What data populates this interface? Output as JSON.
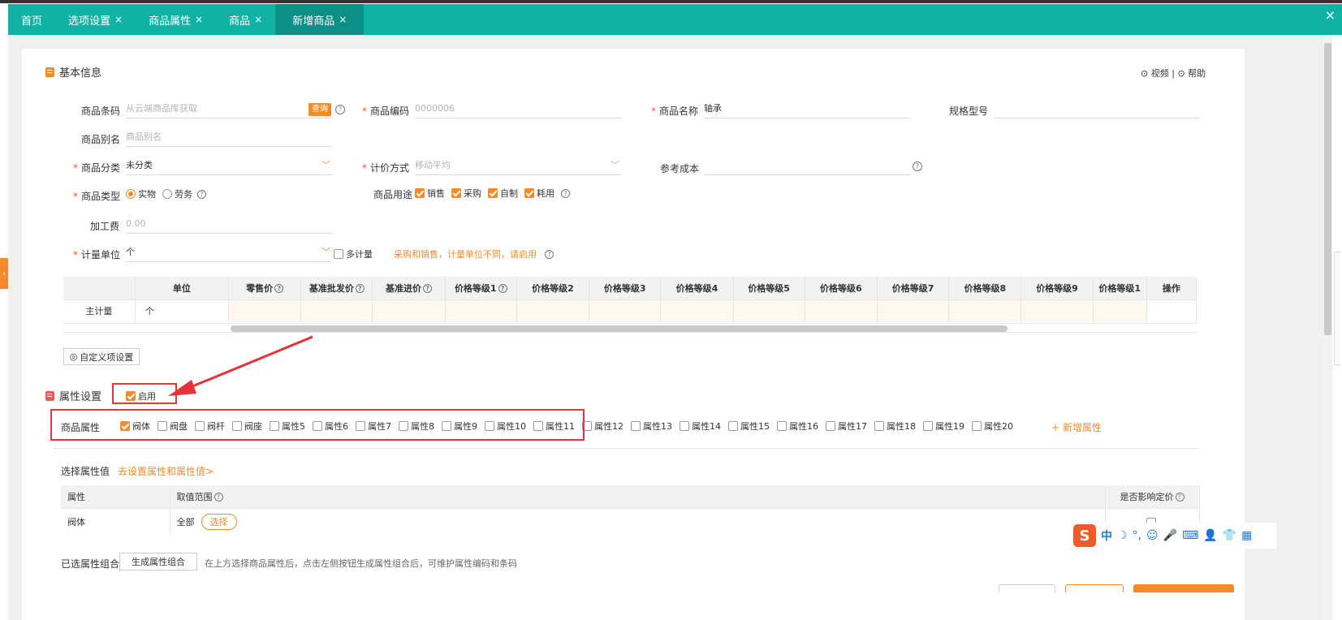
{
  "tabs": [
    {
      "label": "首页",
      "closable": false,
      "active": false
    },
    {
      "label": "选项设置",
      "closable": true,
      "active": false
    },
    {
      "label": "商品属性",
      "closable": true,
      "active": false
    },
    {
      "label": "商品",
      "closable": true,
      "active": false
    },
    {
      "label": "新增商品",
      "closable": true,
      "active": true
    }
  ],
  "tab_close_glyph": "×",
  "window_close_glyph": "×",
  "basic": {
    "title": "基本信息",
    "video_link": "⊙ 视频",
    "separator": "|",
    "help_link": "⊙ 帮助",
    "barcode_label": "商品条码",
    "barcode_placeholder": "从云端商品库获取",
    "query_btn": "查询",
    "code_label": "商品编码",
    "code_placeholder": "0000006",
    "name_label": "商品名称",
    "name_value": "轴承",
    "spec_label": "规格型号",
    "alias_label": "商品别名",
    "alias_placeholder": "商品别名",
    "category_label": "商品分类",
    "category_value": "未分类",
    "pricing_label": "计价方式",
    "pricing_placeholder": "移动平均",
    "refcost_label": "参考成本",
    "type_label": "商品类型",
    "type_physical": "实物",
    "type_service": "劳务",
    "usage_label": "商品用途",
    "usage_sales": "销售",
    "usage_purchase": "采购",
    "usage_selfmade": "自制",
    "usage_consume": "耗用",
    "fee_label": "加工费",
    "fee_placeholder": "0.00",
    "unit_label": "计量单位",
    "unit_value": "个",
    "multi_unit": "多计量",
    "unit_hint": "采购和销售，计量单位不同，请启用",
    "required_mark": "*",
    "qmark": "?",
    "chevron": "﹀"
  },
  "price_table": {
    "headers": [
      "单位",
      "零售价",
      "基准批发价",
      "基准进价",
      "价格等级1",
      "价格等级2",
      "价格等级3",
      "价格等级4",
      "价格等级5",
      "价格等级6",
      "价格等级7",
      "价格等级8",
      "价格等级9",
      "价格等级1",
      "操作"
    ],
    "row_label": "主计量",
    "row_unit": "个"
  },
  "custom_btn": "自定义项设置",
  "custom_icon": "◎",
  "attr": {
    "title": "属性设置",
    "enable_label": "启用",
    "goods_attr_label": "商品属性",
    "items": [
      "阀体",
      "阀盘",
      "阀杆",
      "阀座",
      "属性5",
      "属性6",
      "属性7",
      "属性8",
      "属性9",
      "属性10",
      "属性11",
      "属性12",
      "属性13",
      "属性14",
      "属性15",
      "属性16",
      "属性17",
      "属性18",
      "属性19",
      "属性20"
    ],
    "add_attr": "+ 新增属性",
    "select_values_label": "选择属性值",
    "goto_setting": "去设置属性和属性值>",
    "table_headers": [
      "属性",
      "取值范围",
      "是否影响定价"
    ],
    "row_name": "阀体",
    "row_range": "全部",
    "select_btn": "选择",
    "combo_label": "已选属性组合",
    "combo_btn": "生成属性组合",
    "combo_hint": "在上方选择商品属性后，点击左侧按钮生成属性组合后，可维护属性编码和条码"
  },
  "ime": {
    "logo": "S",
    "lang": "中",
    "moon": "☽",
    "punct": "°,",
    "emoji": "☺",
    "mic": "🎤",
    "keyboard": "⌨",
    "person": "👤",
    "shirt": "👕",
    "grid": "▦"
  },
  "colors": {
    "teal": "#10b3a3",
    "teal_dark": "#0c8f84",
    "orange": "#f38c28",
    "red": "#e5333a"
  }
}
